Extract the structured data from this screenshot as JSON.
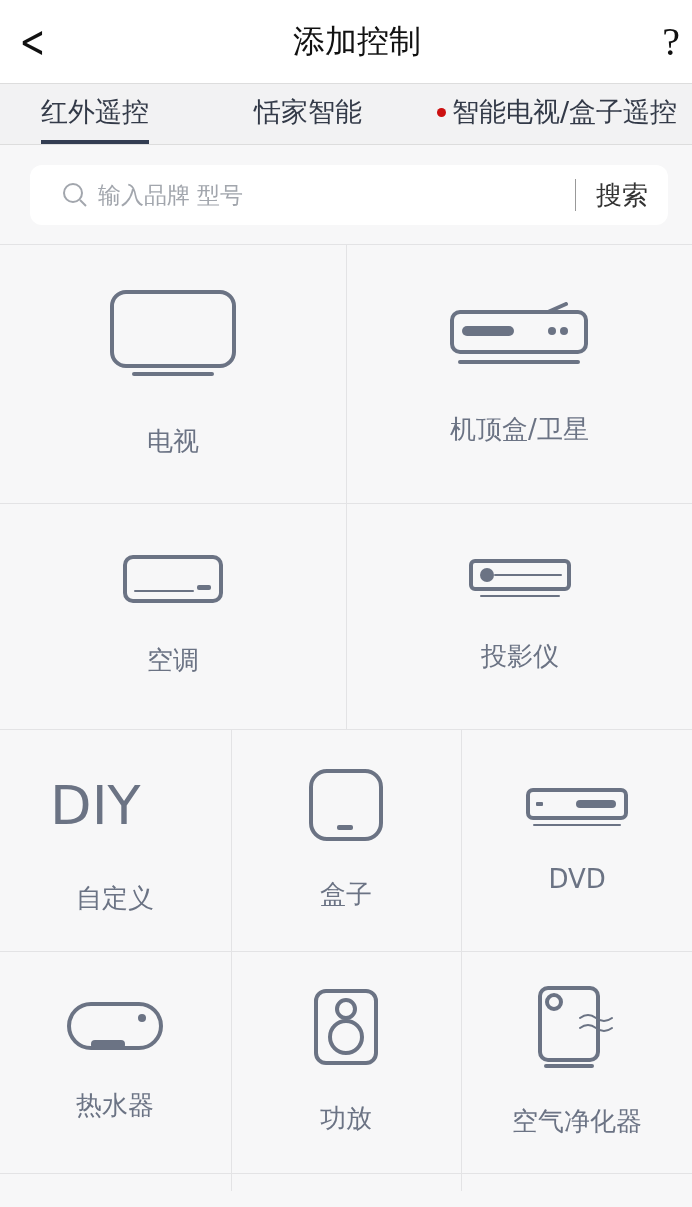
{
  "header": {
    "back": "<",
    "title": "添加控制",
    "help": "?"
  },
  "tabs": [
    {
      "label": "红外遥控",
      "selected": true,
      "dot": false
    },
    {
      "label": "恬家智能",
      "selected": false,
      "dot": false
    },
    {
      "label": "智能电视/盒子遥控",
      "selected": false,
      "dot": true
    }
  ],
  "search": {
    "placeholder": "输入品牌 型号",
    "button": "搜索"
  },
  "device_rows": [
    [
      {
        "kind": "tv",
        "label": "电视"
      },
      {
        "kind": "settop",
        "label": "机顶盒/卫星"
      }
    ],
    [
      {
        "kind": "ac",
        "label": "空调"
      },
      {
        "kind": "projector",
        "label": "投影仪"
      }
    ],
    [
      {
        "kind": "diy",
        "glyph": "DIY",
        "label": "自定义"
      },
      {
        "kind": "box",
        "label": "盒子"
      },
      {
        "kind": "dvd",
        "label": "DVD"
      }
    ],
    [
      {
        "kind": "heater",
        "label": "热水器"
      },
      {
        "kind": "speaker",
        "label": "功放"
      },
      {
        "kind": "purifier",
        "label": "空气净化器"
      }
    ]
  ]
}
